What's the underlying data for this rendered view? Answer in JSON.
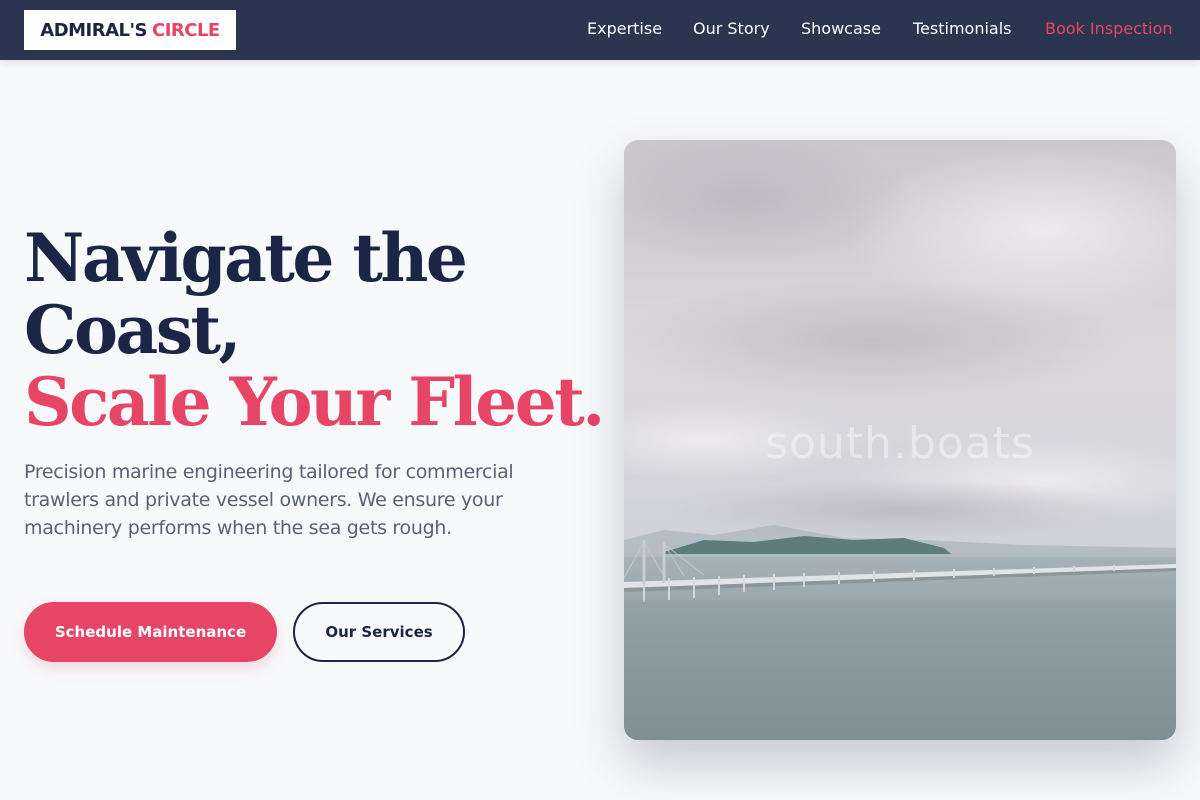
{
  "header": {
    "logo": {
      "primary": "ADMIRAL'S",
      "accent": "CIRCLE"
    },
    "nav": [
      {
        "label": "Expertise"
      },
      {
        "label": "Our Story"
      },
      {
        "label": "Showcase"
      },
      {
        "label": "Testimonials"
      },
      {
        "label": "Book Inspection"
      }
    ]
  },
  "hero": {
    "headline_line1": "Navigate the",
    "headline_line2": "Coast,",
    "headline_line3": "Scale Your Fleet.",
    "subtext": "Precision marine engineering tailored for commercial trawlers and private vessel owners. We ensure your machinery performs when the sea gets rough.",
    "primary_button": "Schedule Maintenance",
    "secondary_button": "Our Services",
    "image": {
      "watermark": "south.boats"
    }
  },
  "colors": {
    "navbar": "#2c3550",
    "accent": "#e64565",
    "heading": "#1b2545",
    "background": "#f8f9fb"
  }
}
